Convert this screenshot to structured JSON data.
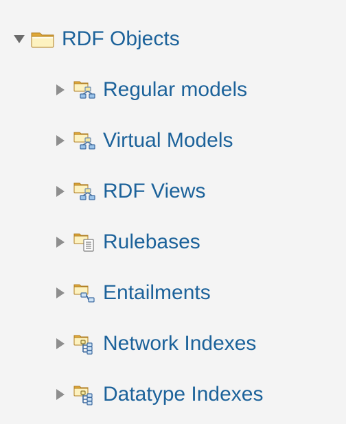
{
  "tree": {
    "root": {
      "label": "RDF Objects",
      "expanded": true,
      "icon": "folder"
    },
    "children": [
      {
        "label": "Regular models",
        "expanded": false,
        "icon": "folder-model"
      },
      {
        "label": "Virtual Models",
        "expanded": false,
        "icon": "folder-model"
      },
      {
        "label": "RDF Views",
        "expanded": false,
        "icon": "folder-model"
      },
      {
        "label": "Rulebases",
        "expanded": false,
        "icon": "folder-list"
      },
      {
        "label": "Entailments",
        "expanded": false,
        "icon": "folder-link"
      },
      {
        "label": "Network Indexes",
        "expanded": false,
        "icon": "folder-tree"
      },
      {
        "label": "Datatype Indexes",
        "expanded": false,
        "icon": "folder-tree"
      }
    ]
  },
  "colors": {
    "link": "#1c629a"
  }
}
